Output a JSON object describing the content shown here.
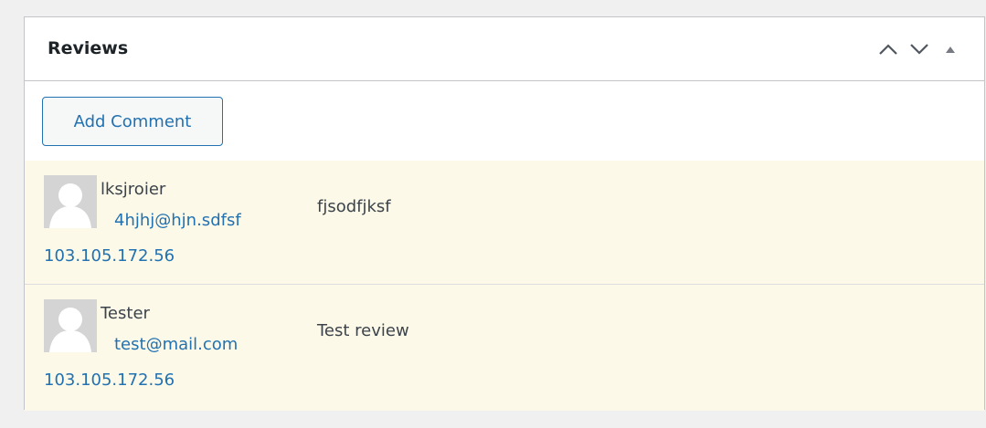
{
  "postbox": {
    "title": "Reviews",
    "controls": {
      "move_up": "chevron-up-icon",
      "move_down": "chevron-down-icon",
      "toggle": "triangle-up-icon"
    }
  },
  "actions": {
    "add_comment_label": "Add Comment"
  },
  "comments": [
    {
      "author": "lksjroier",
      "email": "4hjhj@hjn.sdfsf",
      "ip": "103.105.172.56",
      "text": "fjsodfjksf"
    },
    {
      "author": "Tester",
      "email": "test@mail.com",
      "ip": "103.105.172.56",
      "text": "Test review"
    }
  ],
  "colors": {
    "page_bg": "#f0f0f1",
    "row_bg": "#fcf9e8",
    "link": "#2271b1",
    "border": "#c3c4c7"
  }
}
